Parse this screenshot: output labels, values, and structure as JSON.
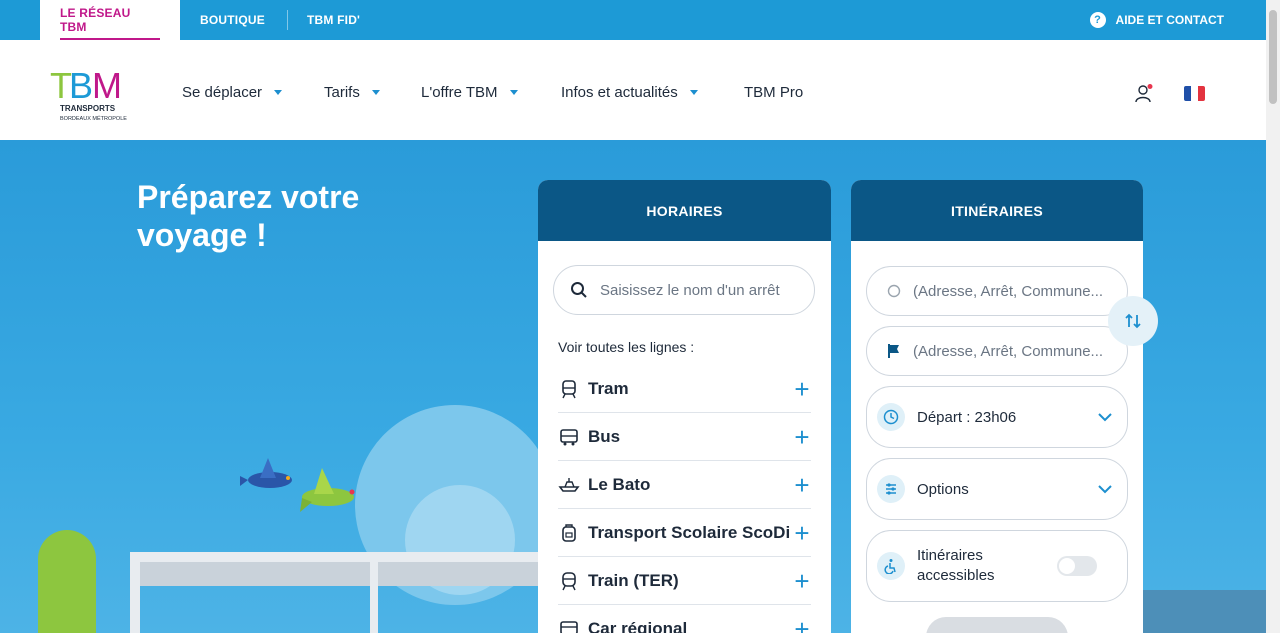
{
  "topbar": {
    "tabs": [
      "LE RÉSEAU TBM",
      "BOUTIQUE",
      "TBM FID'"
    ],
    "help": "AIDE ET CONTACT"
  },
  "header": {
    "logo_text": "TBM",
    "logo_sub1": "TRANSPORTS",
    "logo_sub2": "BORDEAUX MÉTROPOLE",
    "nav": [
      "Se déplacer",
      "Tarifs",
      "L'offre TBM",
      "Infos et actualités",
      "TBM Pro"
    ]
  },
  "hero": {
    "title": "Préparez votre voyage !"
  },
  "horaires": {
    "title": "HORAIRES",
    "search_placeholder": "Saisissez le nom d'un arrêt",
    "lines_label": "Voir toutes les lignes :",
    "lines": [
      "Tram",
      "Bus",
      "Le Bato",
      "Transport Scolaire ScoDi",
      "Train (TER)",
      "Car régional"
    ]
  },
  "itineraires": {
    "title": "ITINÉRAIRES",
    "from_placeholder": "(Adresse, Arrêt, Commune...",
    "to_placeholder": "(Adresse, Arrêt, Commune...",
    "depart": "Départ : 23h06",
    "options": "Options",
    "accessible": "Itinéraires accessibles"
  },
  "colors": {
    "brand_blue": "#1d9ad6",
    "panel_head": "#0b5786",
    "accent_magenta": "#c0188a"
  }
}
